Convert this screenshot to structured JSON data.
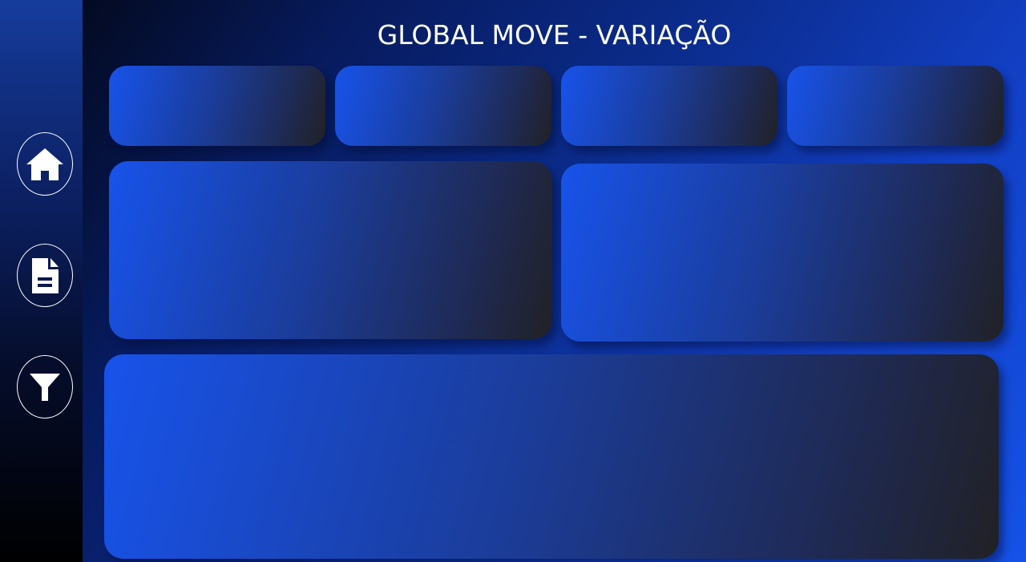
{
  "header": {
    "title": "GLOBAL MOVE - VARIAÇÃO"
  },
  "sidebar": {
    "items": [
      {
        "icon": "home-icon"
      },
      {
        "icon": "document-icon"
      },
      {
        "icon": "filter-icon"
      }
    ]
  },
  "colors": {
    "accent_blue": "#1853ea",
    "card_dark": "#212125",
    "sidebar_top": "#163c9c",
    "sidebar_bottom": "#000000",
    "text": "#ffffff"
  }
}
